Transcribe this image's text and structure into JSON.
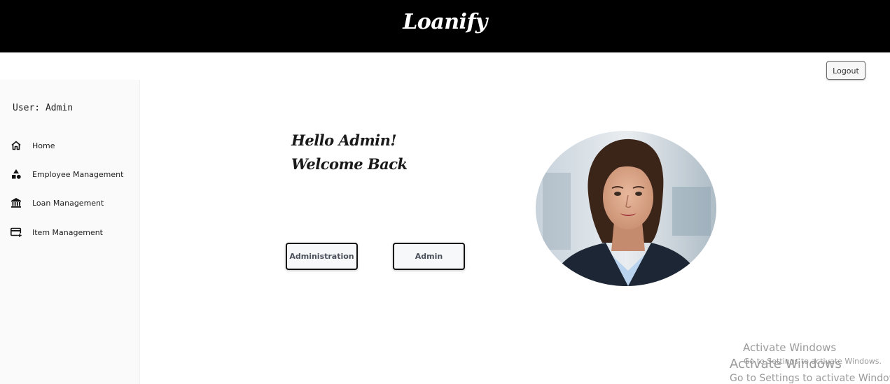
{
  "header": {
    "brand": "Loanify"
  },
  "actions": {
    "logout_label": "Logout"
  },
  "sidebar": {
    "user_label": "User: Admin",
    "items": [
      {
        "label": "Home",
        "icon": "home-icon"
      },
      {
        "label": "Employee Management",
        "icon": "shapes-icon"
      },
      {
        "label": "Loan Management",
        "icon": "bank-icon"
      },
      {
        "label": "Item Management",
        "icon": "card-add-icon"
      }
    ]
  },
  "main": {
    "greeting_line1": "Hello Admin!",
    "greeting_line2": "Welcome Back",
    "buttons": [
      {
        "label": "Administration"
      },
      {
        "label": "Admin"
      }
    ],
    "portrait_icon": "profile-photo"
  },
  "overlay": {
    "watermark_1_title": "Activate Windows",
    "watermark_1_sub": "Go to Settings to activate Windows.",
    "watermark_2_title": "Activate Windows",
    "watermark_2_sub": "Go to Settings to activate Windows."
  },
  "colors": {
    "header_bg": "#000000",
    "sidebar_bg": "#fafafa",
    "button_border": "#111111"
  }
}
